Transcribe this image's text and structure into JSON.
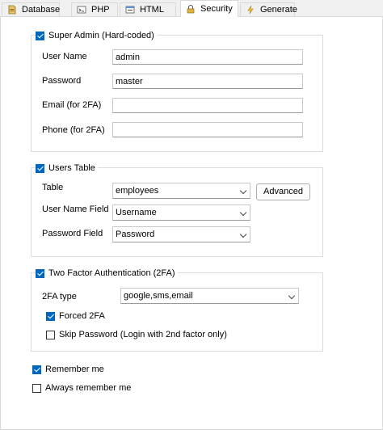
{
  "tabs": [
    {
      "label": "Database",
      "icon": "database-icon",
      "active": false
    },
    {
      "label": "PHP",
      "icon": "php-icon",
      "active": false
    },
    {
      "label": "HTML",
      "icon": "html-icon",
      "active": false
    },
    {
      "label": "Security",
      "icon": "lock-icon",
      "active": true
    },
    {
      "label": "Generate",
      "icon": "lightning-icon",
      "active": false
    }
  ],
  "super_admin": {
    "title": "Super Admin (Hard-coded)",
    "checked": true,
    "user_name_label": "User Name",
    "user_name_value": "admin",
    "password_label": "Password",
    "password_value": "master",
    "email_label": "Email (for 2FA)",
    "email_value": "",
    "phone_label": "Phone (for 2FA)",
    "phone_value": ""
  },
  "users_table": {
    "title": "Users Table",
    "checked": true,
    "table_label": "Table",
    "table_value": "employees",
    "advanced_label": "Advanced",
    "user_name_field_label": "User Name Field",
    "user_name_field_value": "Username",
    "password_field_label": "Password Field",
    "password_field_value": "Password"
  },
  "two_factor": {
    "title": "Two Factor Authentication (2FA)",
    "checked": true,
    "type_label": "2FA type",
    "type_value": "google,sms,email",
    "forced_label": "Forced 2FA",
    "forced_checked": true,
    "skip_password_label": "Skip Password (Login with 2nd factor only)",
    "skip_password_checked": false
  },
  "remember_me": {
    "label": "Remember me",
    "checked": true
  },
  "always_remember_me": {
    "label": "Always remember me",
    "checked": false
  },
  "colors": {
    "accent": "#0067c0",
    "border": "#dcdcdc"
  }
}
